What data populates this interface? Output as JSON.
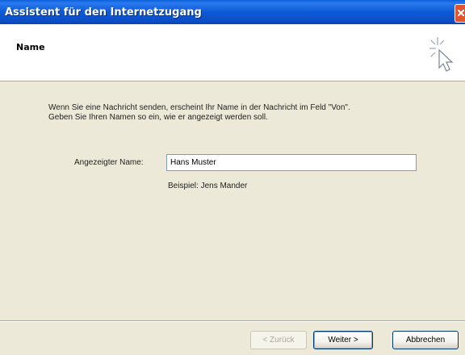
{
  "window": {
    "title": "Assistent für den Internetzugang"
  },
  "header": {
    "title": "Name",
    "icon": "wizard-cursor-icon"
  },
  "intro": {
    "line1": "Wenn Sie eine Nachricht senden, erscheint Ihr Name in der Nachricht im Feld \"Von\".",
    "line2": "Geben Sie Ihren Namen so ein, wie er angezeigt werden soll."
  },
  "form": {
    "display_name_label": "Angezeigter Name:",
    "display_name_value": "Hans Muster",
    "example_text": "Beispiel: Jens Mander"
  },
  "buttons": {
    "back": "< Zurück",
    "next": "Weiter >",
    "cancel": "Abbrechen"
  },
  "colors": {
    "titlebar": "#0b4fc8",
    "close": "#e0552f",
    "dialog_bg": "#ece9d8"
  }
}
